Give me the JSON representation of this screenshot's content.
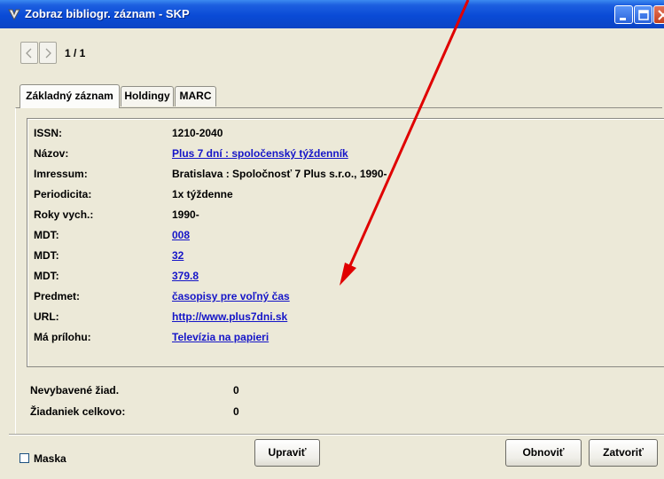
{
  "window": {
    "title": "Zobraz bibliogr. záznam - SKP"
  },
  "navigator": {
    "page_counter": "1 / 1"
  },
  "tabs": [
    {
      "label": "Základný záznam",
      "active": true
    },
    {
      "label": "Holdingy",
      "active": false
    },
    {
      "label": "MARC",
      "active": false
    }
  ],
  "record": {
    "rows": [
      {
        "label": "ISSN:",
        "value": "1210-2040",
        "link": false
      },
      {
        "label": "Názov:",
        "value": "Plus 7 dní : spoločenský týždenník",
        "link": true
      },
      {
        "label": "Imressum:",
        "value": "Bratislava : Spoločnosť 7 Plus s.r.o., 1990-",
        "link": false
      },
      {
        "label": "Periodicita:",
        "value": "1x týždenne",
        "link": false
      },
      {
        "label": "Roky vych.:",
        "value": "1990-",
        "link": false
      },
      {
        "label": "MDT:",
        "value": "008 ",
        "link": true
      },
      {
        "label": "MDT:",
        "value": "32 ",
        "link": true
      },
      {
        "label": "MDT:",
        "value": "379.8 ",
        "link": true
      },
      {
        "label": "Predmet:",
        "value": "časopisy pre voľný čas ",
        "link": true
      },
      {
        "label": "URL:",
        "value": "http://www.plus7dni.sk ",
        "link": true
      },
      {
        "label": "Má prílohu:",
        "value": "Televízia na papieri ",
        "link": true
      }
    ]
  },
  "stats": {
    "unselected_label": "Nevybavené žiad.",
    "unselected_value": "0",
    "total_label": "Žiadaniek celkovo:",
    "total_value": "0"
  },
  "footer": {
    "mask_label": "Maska",
    "mask_checked": false,
    "edit_label": "Upraviť",
    "refresh_label": "Obnoviť",
    "close_label": "Zatvoriť"
  },
  "colors": {
    "titlebar": "#0a4bd6",
    "link": "#1515c8",
    "annotation_arrow": "#e00000",
    "face": "#ece9d8"
  }
}
